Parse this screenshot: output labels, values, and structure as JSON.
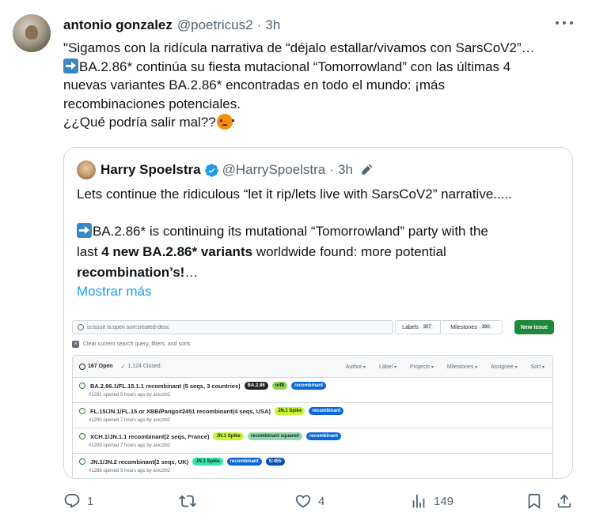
{
  "tweet": {
    "author_name": "antonio gonzalez",
    "author_handle": "@poetricus2",
    "separator": "·",
    "time": "3h",
    "lines": [
      "\"Sigamos con la ridícula narrativa de “déjalo estallar/vivamos con SarsCoV2”…",
      "BA.2.86* continúa su fiesta mutacional “Tomorrowland” con las últimas 4",
      "nuevas variantes BA.2.86* encontradas en todo el mundo: ¡más",
      "recombinaciones potenciales.",
      "¿¿Qué podría salir mal??"
    ],
    "icons": {
      "more": "more-icon",
      "arrow": "right-arrow-emoji",
      "angry": "angry-face-emoji"
    }
  },
  "quote": {
    "author_name": "Harry Spoelstra",
    "author_handle": "@HarrySpoelstra",
    "separator": "·",
    "time": "3h",
    "line1": "Lets continue the ridiculous “let it rip/lets live with SarsCoV2” narrative.....",
    "line2": "BA.2.86* is continuing its mutational “Tomorrowland” party with the",
    "line3_prefix": "last ",
    "line3_bold": "4 new BA.2.86* variants",
    "line3_suffix": " worldwide found: more potential",
    "line4_bold": "recombination’s!",
    "line4_suffix": "…",
    "show_more": "Mostrar más",
    "colors": {
      "verified": "#1d9bf0",
      "link": "#1d9bf0"
    }
  },
  "github": {
    "search_value": "is:issue is:open sort:created-desc",
    "labels_button": "Labels",
    "labels_count": "307",
    "milestones_button": "Milestones",
    "milestones_count": "390",
    "new_issue_button": "New issue",
    "clear_text": "Clear current search query, filters, and sorts",
    "open_count": "167 Open",
    "closed_count": "1,124 Closed",
    "filters": [
      "Author",
      "Label",
      "Projects",
      "Milestones",
      "Assignee",
      "Sort"
    ],
    "issues": [
      {
        "title": "BA.2.86.1/FL.15.1.1 recombinant (5 seqs, 3 countries)",
        "meta": "#1291 opened 5 hours ago by aviczhl2",
        "labels": [
          {
            "text": "BA.2.86",
            "bg": "#1f2328",
            "fg": "#ffffff"
          },
          {
            "text": "orf8",
            "bg": "#8bd450",
            "fg": "#1f2328"
          },
          {
            "text": "recombinant",
            "bg": "#0969da",
            "fg": "#ffffff"
          }
        ]
      },
      {
        "title": "FL.15/JN.1/FL.15 or XBB/Pango#2451 recombinant(4 seqs, USA)",
        "meta": "#1290 opened 7 hours ago by aviczhl2",
        "labels": [
          {
            "text": "JN.1 Spike",
            "bg": "#c6f432",
            "fg": "#1f2328"
          },
          {
            "text": "recombinant",
            "bg": "#0969da",
            "fg": "#ffffff"
          }
        ]
      },
      {
        "title": "XCH.1/JN.1.1 recombinant(2 seqs, France)",
        "meta": "#1289 opened 7 hours ago by aviczhl2",
        "labels": [
          {
            "text": "JN.1 Spike",
            "bg": "#c6f432",
            "fg": "#1f2328"
          },
          {
            "text": "recombinant squared",
            "bg": "#8fd9a8",
            "fg": "#1f2328"
          },
          {
            "text": "recombinant",
            "bg": "#0969da",
            "fg": "#ffffff"
          }
        ]
      },
      {
        "title": "JN.1/JN.2 recombinant(2 seqs, UK)",
        "meta": "#1288 opened 9 hours ago by aviczhl2",
        "labels": [
          {
            "text": "JN.1 Spike",
            "bg": "#2ee6a8",
            "fg": "#1f2328"
          },
          {
            "text": "recombinant",
            "bg": "#0969da",
            "fg": "#ffffff"
          },
          {
            "text": "S:455",
            "bg": "#0550ae",
            "fg": "#ffffff"
          }
        ]
      }
    ]
  },
  "actions": {
    "reply_count": "1",
    "retweet_count": "",
    "like_count": "4",
    "views_count": "149",
    "icons": [
      "reply-icon",
      "retweet-icon",
      "like-icon",
      "views-icon",
      "bookmark-icon",
      "share-icon"
    ]
  }
}
